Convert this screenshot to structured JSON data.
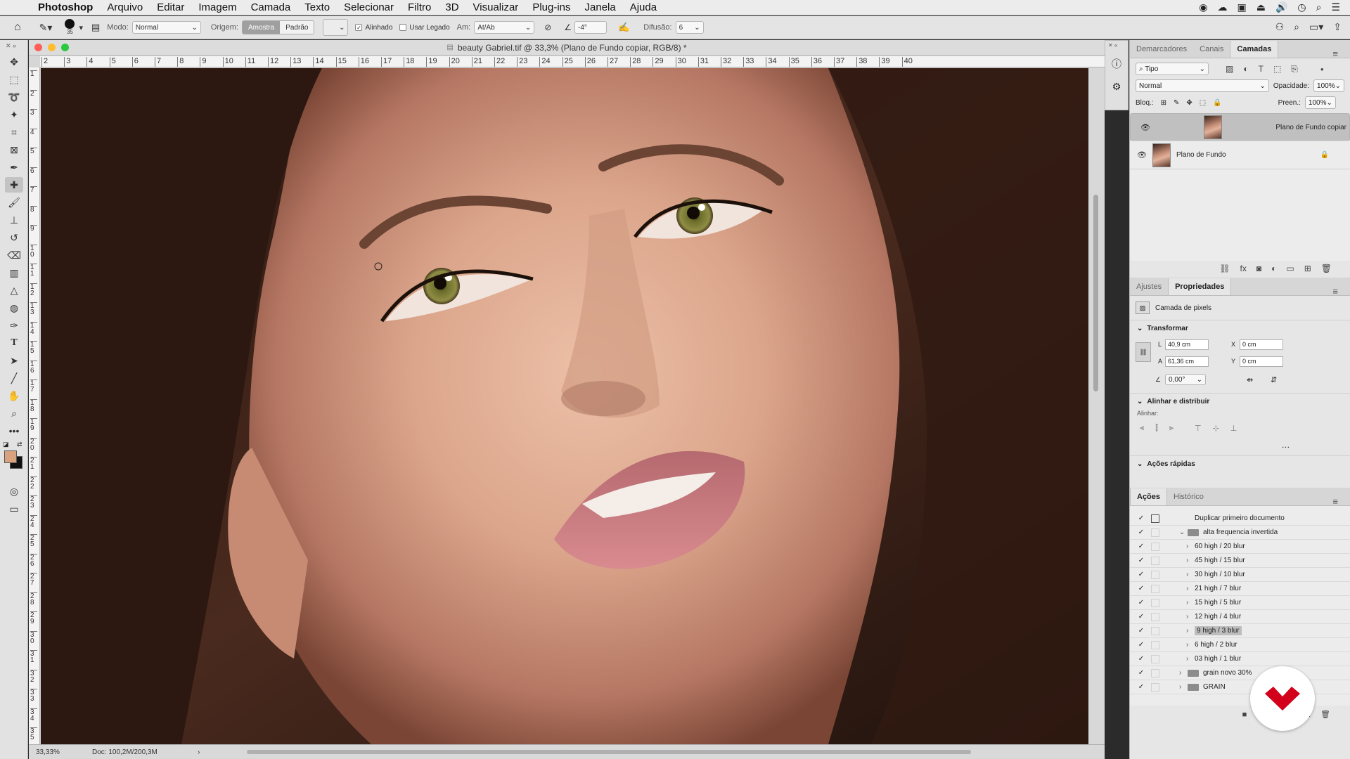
{
  "menubar": {
    "app": "Photoshop",
    "items": [
      "Arquivo",
      "Editar",
      "Imagem",
      "Camada",
      "Texto",
      "Selecionar",
      "Filtro",
      "3D",
      "Visualizar",
      "Plug-ins",
      "Janela",
      "Ajuda"
    ]
  },
  "options": {
    "brush_size": "35",
    "mode_label": "Modo:",
    "mode_value": "Normal",
    "origin_label": "Origem:",
    "origin_sample": "Amostra",
    "origin_pattern": "Padrão",
    "aligned_label": "Alinhado",
    "legacy_label": "Usar Legado",
    "sample_label": "Am:",
    "sample_value": "At/Ab",
    "angle_value": "-4°",
    "diffusion_label": "Difusão:",
    "diffusion_value": "6"
  },
  "document": {
    "title": "beauty Gabriel.tif @ 33,3% (Plano de Fundo copiar, RGB/8) *",
    "h_ruler": [
      "2",
      "3",
      "4",
      "5",
      "6",
      "7",
      "8",
      "9",
      "10",
      "11",
      "12",
      "13",
      "14",
      "15",
      "16",
      "17",
      "18",
      "19",
      "20",
      "21",
      "22",
      "23",
      "24",
      "25",
      "26",
      "27",
      "28",
      "29",
      "30",
      "31",
      "32",
      "33",
      "34",
      "35",
      "36",
      "37",
      "38",
      "39",
      "40"
    ],
    "v_ruler": [
      "1",
      "2",
      "3",
      "4",
      "5",
      "6",
      "7",
      "8",
      "9",
      "10",
      "11",
      "12",
      "13",
      "14",
      "15",
      "16",
      "17",
      "18",
      "19",
      "20",
      "21",
      "22",
      "23",
      "24",
      "25",
      "26",
      "27",
      "28",
      "29",
      "30",
      "31",
      "32",
      "33",
      "34",
      "35"
    ],
    "zoom": "33,33%",
    "doc_info": "Doc: 100,2M/200,3M"
  },
  "layers_panel": {
    "tabs": [
      "Demarcadores",
      "Canais",
      "Camadas"
    ],
    "active_tab": "Camadas",
    "filter_value": "Tipo",
    "blend_mode": "Normal",
    "opacity_label": "Opacidade:",
    "opacity_value": "100%",
    "lock_label": "Bloq.:",
    "fill_label": "Preen.:",
    "fill_value": "100%",
    "layers": [
      {
        "name": "Plano de Fundo copiar",
        "selected": true,
        "locked": false
      },
      {
        "name": "Plano de Fundo",
        "selected": false,
        "locked": true
      }
    ]
  },
  "properties_panel": {
    "tabs": [
      "Ajustes",
      "Propriedades"
    ],
    "active_tab": "Propriedades",
    "kind": "Camada de pixels",
    "transform_title": "Transformar",
    "w_label": "L",
    "w_value": "40,9 cm",
    "h_label": "A",
    "h_value": "61,36 cm",
    "x_label": "X",
    "x_value": "0 cm",
    "y_label": "Y",
    "y_value": "0 cm",
    "angle_value": "0,00°",
    "align_title": "Alinhar e distribuir",
    "align_label": "Alinhar:",
    "quick_title": "Ações rápidas"
  },
  "actions_panel": {
    "tabs": [
      "Ações",
      "Histórico"
    ],
    "active_tab": "Ações",
    "items": [
      {
        "label": "Duplicar primeiro documento",
        "indent": 3,
        "type": "step",
        "dialog": true
      },
      {
        "label": "alta frequencia invertida",
        "indent": 2,
        "type": "set-open"
      },
      {
        "label": "60 high / 20 blur",
        "indent": 3,
        "type": "action"
      },
      {
        "label": "45 high / 15 blur",
        "indent": 3,
        "type": "action"
      },
      {
        "label": "30 high / 10 blur",
        "indent": 3,
        "type": "action"
      },
      {
        "label": "21 high / 7 blur",
        "indent": 3,
        "type": "action"
      },
      {
        "label": "15 high / 5 blur",
        "indent": 3,
        "type": "action"
      },
      {
        "label": "12 high / 4 blur",
        "indent": 3,
        "type": "action"
      },
      {
        "label": "9 high / 3 blur",
        "indent": 3,
        "type": "action",
        "highlight": true
      },
      {
        "label": "6 high / 2 blur",
        "indent": 3,
        "type": "action"
      },
      {
        "label": "03 high / 1 blur",
        "indent": 3,
        "type": "action"
      },
      {
        "label": "grain novo 30%",
        "indent": 2,
        "type": "set"
      },
      {
        "label": "GRAIN",
        "indent": 2,
        "type": "set"
      }
    ]
  },
  "colors": {
    "foreground": "#d9a27f",
    "background": "#111111",
    "brand_badge": "#d3001b"
  }
}
